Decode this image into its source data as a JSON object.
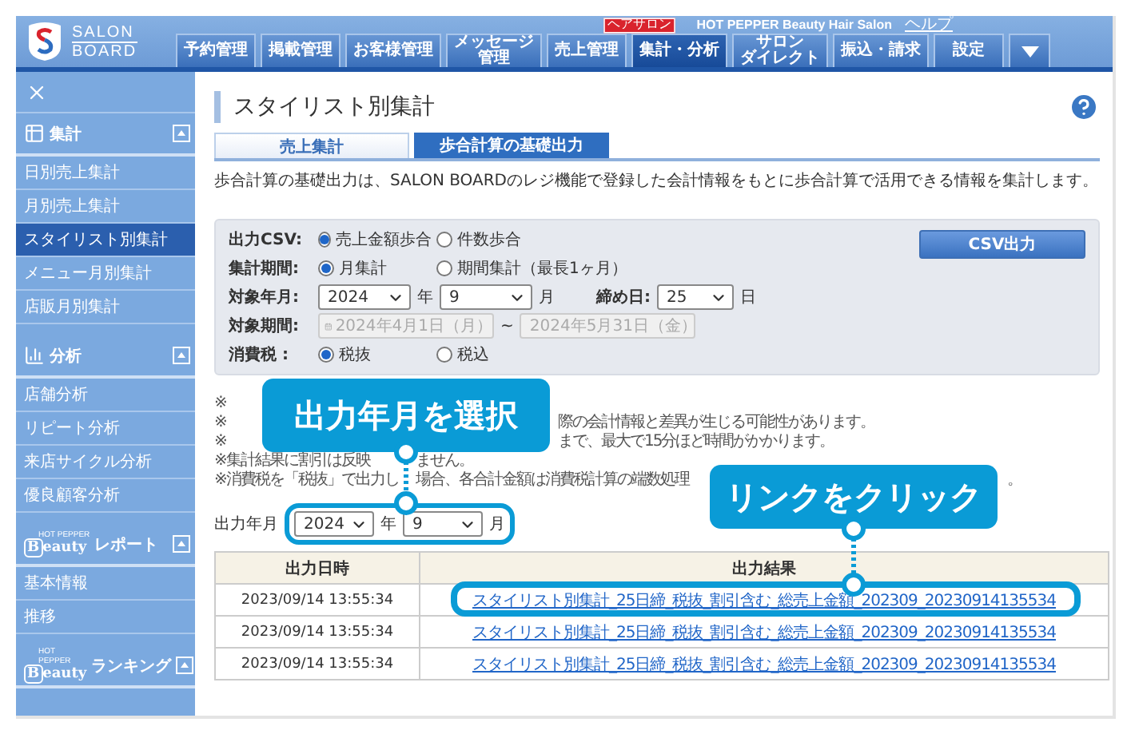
{
  "header": {
    "logo_top": "SALON",
    "logo_bottom": "BOARD",
    "badge": "ヘアサロン",
    "brand": "HOT PEPPER Beauty Hair Salon",
    "help": "ヘルプ",
    "nav": [
      {
        "kind": "tab",
        "lines": [
          "予約管理"
        ],
        "selected": false
      },
      {
        "kind": "tab",
        "lines": [
          "掲載管理"
        ],
        "selected": false
      },
      {
        "kind": "tab",
        "lines": [
          "お客様管理"
        ],
        "selected": false
      },
      {
        "kind": "tab",
        "lines": [
          "メッセージ",
          "管理"
        ],
        "selected": false
      },
      {
        "kind": "tab",
        "lines": [
          "売上管理"
        ],
        "selected": false
      },
      {
        "kind": "tab",
        "lines": [
          "集計・分析"
        ],
        "selected": true
      },
      {
        "kind": "tab",
        "lines": [
          "サロン",
          "ダイレクト"
        ],
        "selected": false
      },
      {
        "kind": "tab",
        "lines": [
          "振込・請求"
        ],
        "selected": false
      },
      {
        "kind": "tab",
        "lines": [
          "設定"
        ],
        "selected": false
      },
      {
        "kind": "menu",
        "selected": false
      }
    ]
  },
  "sidebar": {
    "sections": [
      {
        "kind": "table",
        "title": "集計",
        "expanded": true,
        "items": [
          {
            "label": "日別売上集計",
            "selected": false
          },
          {
            "label": "月別売上集計",
            "selected": false
          },
          {
            "label": "スタイリスト別集計",
            "selected": true
          },
          {
            "label": "メニュー月別集計",
            "selected": false
          },
          {
            "label": "店販月別集計",
            "selected": false
          }
        ]
      },
      {
        "kind": "chart",
        "title": "分析",
        "expanded": true,
        "items": [
          {
            "label": "店舗分析",
            "selected": false
          },
          {
            "label": "リピート分析",
            "selected": false
          },
          {
            "label": "来店サイクル分析",
            "selected": false
          },
          {
            "label": "優良顧客分析",
            "selected": false
          }
        ]
      },
      {
        "kind": "brand",
        "logo_small": "HOT PEPPER",
        "logo": "Beauty",
        "title": "レポート",
        "expanded": true,
        "items": [
          {
            "label": "基本情報",
            "selected": false
          },
          {
            "label": "推移",
            "selected": false
          }
        ]
      },
      {
        "kind": "brand",
        "logo_small": "HOT PEPPER",
        "logo": "Beauty",
        "title": "ランキング",
        "expanded": true
      }
    ]
  },
  "page": {
    "title": "スタイリスト別集計",
    "tabs": [
      {
        "label": "売上集計",
        "selected": false
      },
      {
        "label": "歩合計算の基礎出力",
        "selected": true
      }
    ],
    "description": "歩合計算の基礎出力は、SALON BOARDのレジ機能で登録した会計情報をもとに歩合計算で活用できる情報を集計します。",
    "form": {
      "csv_button": "CSV出力",
      "rows": [
        {
          "kind": "radio",
          "label": "出力CSV:",
          "options": [
            {
              "label": "売上金額歩合",
              "selected": true
            },
            {
              "label": "件数歩合",
              "selected": false
            }
          ]
        },
        {
          "kind": "radio",
          "label": "集計期間:",
          "options": [
            {
              "label": "月集計",
              "selected": true
            },
            {
              "label": "期間集計（最長1ヶ月）",
              "selected": false
            }
          ]
        },
        {
          "kind": "month",
          "label": "対象年月:",
          "year": "2024",
          "year_unit": "年",
          "month": "9",
          "month_unit": "月",
          "closing_label": "締め日:",
          "closing_day": "25",
          "day_unit": "日"
        },
        {
          "kind": "period",
          "label": "対象期間:",
          "start": "2024年4月1日（月）",
          "separator": "~",
          "end": "2024年5月31日（金）",
          "disabled": true
        },
        {
          "kind": "radio",
          "label": "消費税 :",
          "options": [
            {
              "label": "税抜",
              "selected": true
            },
            {
              "label": "税込",
              "selected": false
            }
          ]
        }
      ]
    },
    "notes": [
      {
        "parts": [
          "※"
        ]
      },
      {
        "parts": [
          "※",
          "際の会計情報と差異が生じる可能性があります。"
        ]
      },
      {
        "parts": [
          "※",
          "まで、最大で15分ほど時間がかかります。"
        ]
      },
      {
        "parts": [
          "※集計結果に割引は反映",
          "ません。"
        ]
      },
      {
        "parts": [
          "※消費税を「税抜」で出力し",
          "場合、各合計金額は消費税計算の端数処理",
          "。"
        ]
      }
    ],
    "output": {
      "label": "出力年月",
      "year": "2024",
      "year_unit": "年",
      "month": "9",
      "month_unit": "月"
    },
    "table": {
      "columns": [
        "出力日時",
        "出力結果"
      ],
      "rows": [
        {
          "date": "2023/09/14 13:55:34",
          "link": "スタイリスト別集計_25日締_税抜_割引含む_総売上金額_202309_20230914135534"
        },
        {
          "date": "2023/09/14 13:55:34",
          "link": "スタイリスト別集計_25日締_税抜_割引含む_総売上金額_202309_20230914135534"
        },
        {
          "date": "2023/09/14 13:55:34",
          "link": "スタイリスト別集計_25日締_税抜_割引含む_総売上金額_202309_20230914135534"
        }
      ]
    },
    "callouts": [
      {
        "text": "出力年月を選択"
      },
      {
        "text": "リンクをクリック"
      }
    ]
  }
}
